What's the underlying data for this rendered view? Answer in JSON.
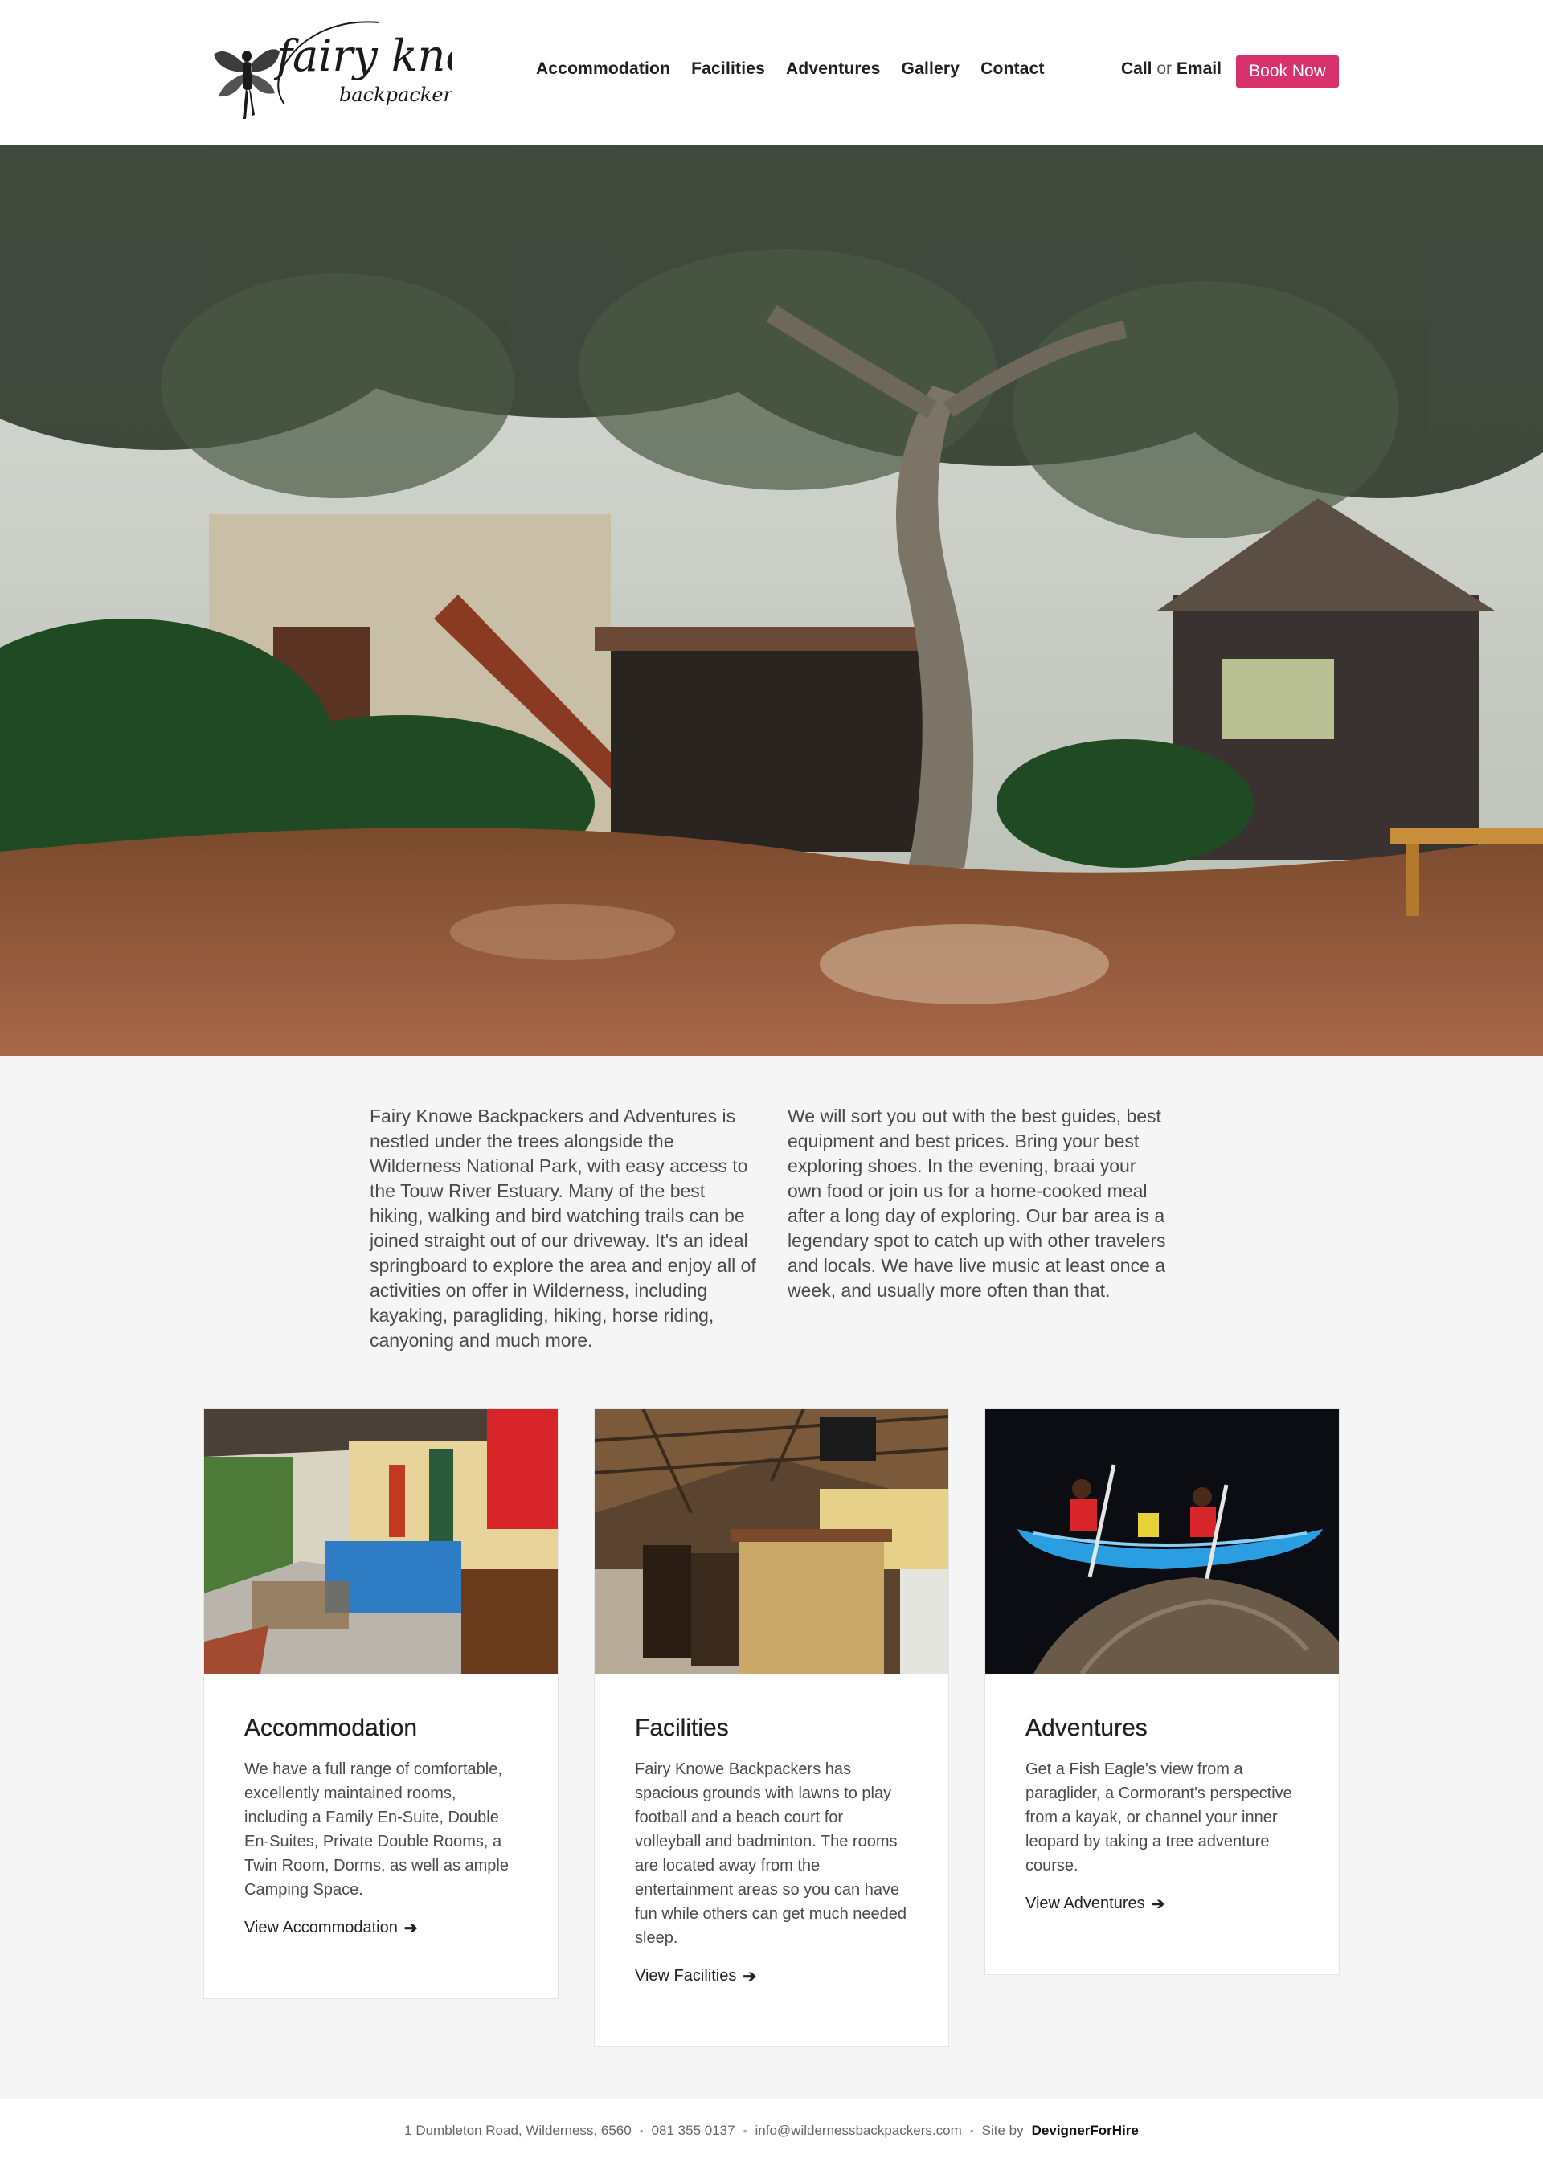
{
  "brand": {
    "name_main": "fairy knowe",
    "name_sub": "backpackers"
  },
  "nav": {
    "items": [
      "Accommodation",
      "Facilities",
      "Adventures",
      "Gallery",
      "Contact"
    ]
  },
  "header_contact": {
    "call": "Call",
    "or": "or",
    "email": "Email",
    "book": "Book Now",
    "book_color": "#d8326c"
  },
  "intro": {
    "left": "Fairy Knowe Backpackers and Adventures is nestled under the trees alongside the Wilderness National Park, with easy access to the Touw River Estuary. Many of the best hiking, walking and bird watching trails can be joined straight out of our driveway. It's an ideal springboard to explore the area and enjoy all of activities on offer in Wilderness, including kayaking, paragliding, hiking, horse riding, canyoning and much more.",
    "right": "We will sort you out with the best guides, best equipment and best prices. Bring your best exploring shoes. In the evening, braai your own food or join us for a home-cooked meal after a long day of exploring. Our bar area is a legendary spot to catch up with other travelers and locals. We have live music at least once a week, and usually more often than that."
  },
  "cards": [
    {
      "title": "Accommodation",
      "text": "We have a full range of comfortable, excellently maintained rooms, including a Family En-Suite, Double En-Suites, Private Double Rooms, a Twin Room, Dorms, as well as ample Camping Space.",
      "link": "View Accommodation"
    },
    {
      "title": "Facilities",
      "text": "Fairy Knowe Backpackers has spacious grounds with lawns to play football and a beach court for volleyball and badminton. The rooms are located away from the entertainment areas so you can have fun while others can get much needed sleep.",
      "link": "View Facilities"
    },
    {
      "title": "Adventures",
      "text": "Get a Fish Eagle's view from a paraglider, a Cormorant's perspective from a kayak, or channel your inner leopard by taking a tree adventure course.",
      "link": "View Adventures"
    }
  ],
  "icons": {
    "link_arrow": "arrow-right-icon"
  },
  "footer": {
    "address": "1 Dumbleton Road, Wilderness, 6560",
    "phone": "081 355 0137",
    "email": "info@wildernessbackpackers.com",
    "site_by": "Site by",
    "credit": "DevignerForHire"
  }
}
